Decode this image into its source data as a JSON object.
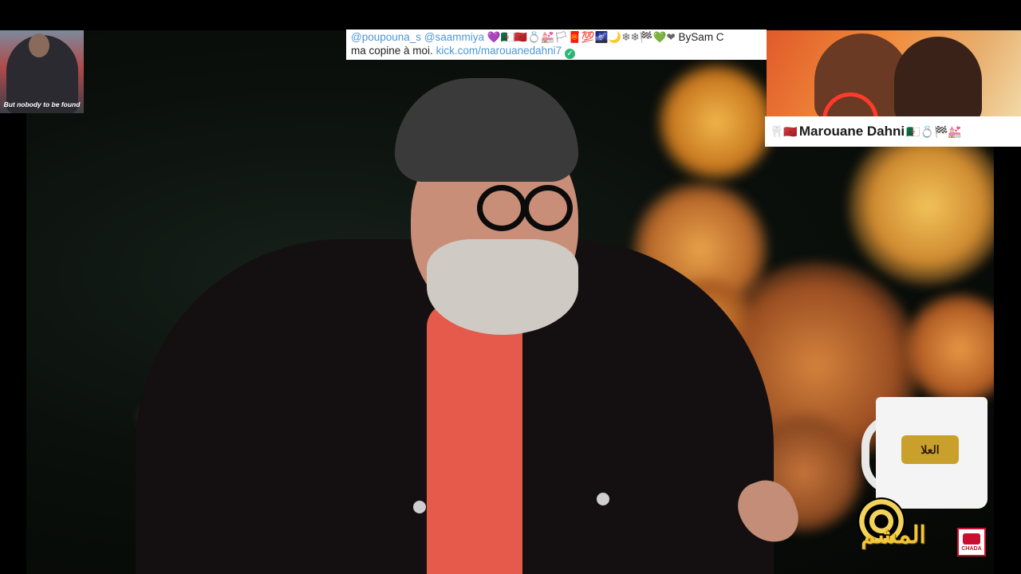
{
  "overlay_left": {
    "caption": "But nobody to be found"
  },
  "chat": {
    "mention1": "@poupouna_s",
    "mention2": "@saammiya",
    "emojis": "💜🇩🇿🇲🇦💍💒🏳🧧💯🌌🌙❄❄🏁💚❤",
    "by": "BySam C",
    "message": "ma copine à moi.",
    "link": "kick.com/marouanedahni7"
  },
  "streamer": {
    "prefix_emojis": "🦷🇲🇦",
    "name": "Marouane Dahni",
    "suffix_emojis": "🇩🇿💍🏁💒"
  },
  "tv": {
    "mug_logo": "العلا",
    "show_logo": "المشم",
    "channel_logo": "CHADA"
  }
}
